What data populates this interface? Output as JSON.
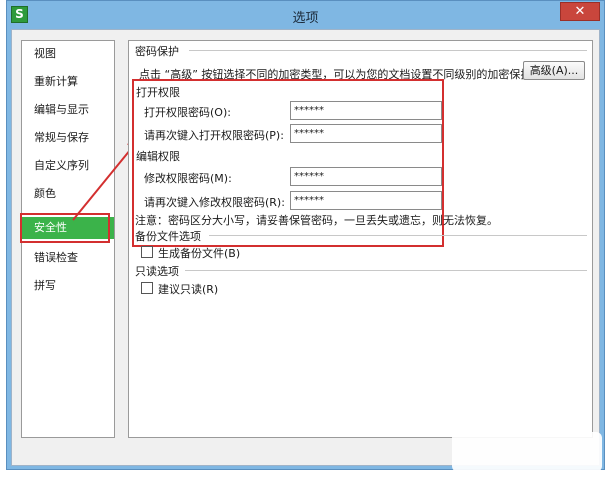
{
  "window": {
    "title": "选项",
    "app_icon_glyph": "S",
    "close_glyph": "✕"
  },
  "sidebar": {
    "items": [
      {
        "label": "视图"
      },
      {
        "label": "重新计算"
      },
      {
        "label": "编辑与显示"
      },
      {
        "label": "常规与保存"
      },
      {
        "label": "自定义序列"
      },
      {
        "label": "颜色"
      },
      {
        "label": "安全性",
        "selected": true
      },
      {
        "label": "错误检查"
      },
      {
        "label": "拼写"
      }
    ]
  },
  "security": {
    "password_group_title": "密码保护",
    "note": "点击 “高级” 按钮选择不同的加密类型，可以为您的文档设置不同级别的加密保护。",
    "advanced_button": "高级(A)...",
    "open_permission_title": "打开权限",
    "open_password_label": "打开权限密码(O):",
    "open_password_value": "******",
    "open_password_confirm_label": "请再次键入打开权限密码(P):",
    "open_password_confirm_value": "******",
    "edit_permission_title": "编辑权限",
    "edit_password_label": "修改权限密码(M):",
    "edit_password_value": "******",
    "edit_password_confirm_label": "请再次键入修改权限密码(R):",
    "edit_password_confirm_value": "******",
    "warning": "注意：密码区分大小写，请妥善保管密码，一旦丢失或遗忘，则无法恢复。",
    "backup_group_title": "备份文件选项",
    "backup_checkbox_label": "生成备份文件(B)",
    "readonly_group_title": "只读选项",
    "readonly_checkbox_label": "建议只读(R)"
  },
  "colors": {
    "title_bar": "#7fb7e3",
    "selected": "#3bb34a",
    "highlight": "#d32f2f"
  }
}
